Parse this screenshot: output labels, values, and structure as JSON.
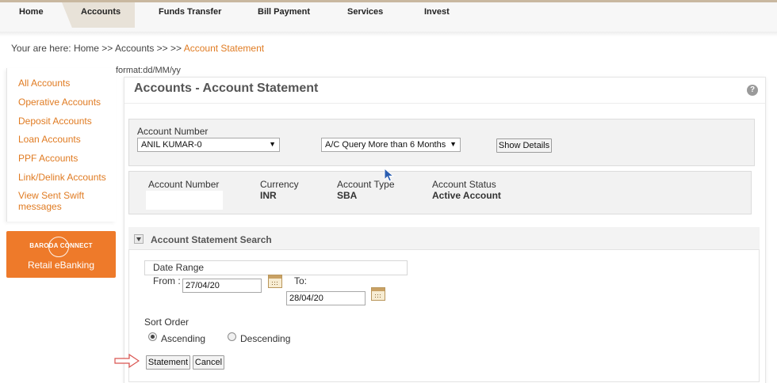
{
  "nav": {
    "tabs": [
      {
        "label": "Home"
      },
      {
        "label": "Accounts"
      },
      {
        "label": "Funds Transfer"
      },
      {
        "label": "Bill Payment"
      },
      {
        "label": "Services"
      },
      {
        "label": "Invest"
      }
    ],
    "active_index": 1
  },
  "breadcrumb": {
    "prefix": "Your are here: Home >> Accounts >> >> ",
    "current": "Account Statement"
  },
  "sidebar": {
    "items": [
      {
        "label": "All Accounts"
      },
      {
        "label": "Operative Accounts"
      },
      {
        "label": "Deposit Accounts"
      },
      {
        "label": "Loan Accounts"
      },
      {
        "label": "PPF Accounts"
      },
      {
        "label": "Link/Delink Accounts"
      },
      {
        "label": "View Sent Swift"
      },
      {
        "label": "messages"
      }
    ]
  },
  "promo": {
    "brand": "BARODA CONNECT",
    "sub": "Retail eBanking"
  },
  "format_note": "format:dd/MM/yy",
  "page": {
    "title": "Accounts - Account Statement",
    "help": "?"
  },
  "account_selector": {
    "label": "Account Number",
    "account_value": "ANIL KUMAR-0",
    "query_value": "A/C Query More than 6 Months",
    "show_details": "Show Details"
  },
  "account_info": {
    "account_number_label": "Account Number",
    "currency_label": "Currency",
    "currency_value": "INR",
    "type_label": "Account Type",
    "type_value": "SBA",
    "status_label": "Account Status",
    "status_value": "Active Account"
  },
  "search": {
    "title": "Account Statement Search",
    "date_range_label": "Date Range",
    "from_label": "From :",
    "from_value": "27/04/20",
    "to_label": "To:",
    "to_value": "28/04/20",
    "sort_label": "Sort Order",
    "ascending_label": "Ascending",
    "descending_label": "Descending",
    "sort_selected": "Ascending",
    "statement_button": "Statement",
    "cancel_button": "Cancel"
  },
  "colors": {
    "accent": "#e07b22",
    "promo": "#ee7a2a",
    "panel_bg": "#f2f2f2"
  }
}
